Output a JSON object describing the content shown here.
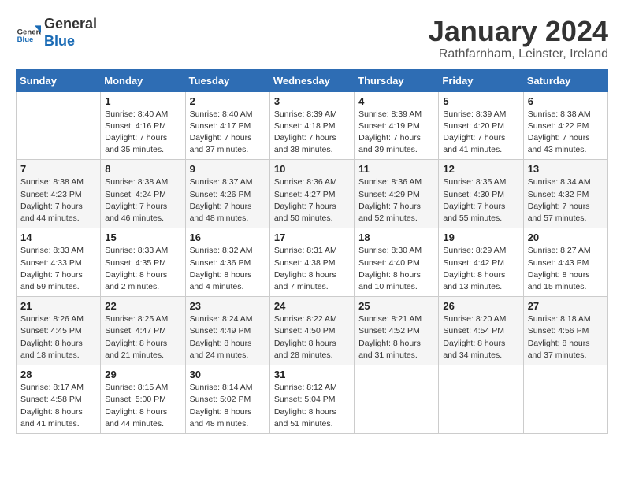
{
  "header": {
    "logo_general": "General",
    "logo_blue": "Blue",
    "month_title": "January 2024",
    "location": "Rathfarnham, Leinster, Ireland"
  },
  "calendar": {
    "days_of_week": [
      "Sunday",
      "Monday",
      "Tuesday",
      "Wednesday",
      "Thursday",
      "Friday",
      "Saturday"
    ],
    "weeks": [
      [
        {
          "day": "",
          "info": ""
        },
        {
          "day": "1",
          "info": "Sunrise: 8:40 AM\nSunset: 4:16 PM\nDaylight: 7 hours\nand 35 minutes."
        },
        {
          "day": "2",
          "info": "Sunrise: 8:40 AM\nSunset: 4:17 PM\nDaylight: 7 hours\nand 37 minutes."
        },
        {
          "day": "3",
          "info": "Sunrise: 8:39 AM\nSunset: 4:18 PM\nDaylight: 7 hours\nand 38 minutes."
        },
        {
          "day": "4",
          "info": "Sunrise: 8:39 AM\nSunset: 4:19 PM\nDaylight: 7 hours\nand 39 minutes."
        },
        {
          "day": "5",
          "info": "Sunrise: 8:39 AM\nSunset: 4:20 PM\nDaylight: 7 hours\nand 41 minutes."
        },
        {
          "day": "6",
          "info": "Sunrise: 8:38 AM\nSunset: 4:22 PM\nDaylight: 7 hours\nand 43 minutes."
        }
      ],
      [
        {
          "day": "7",
          "info": "Sunrise: 8:38 AM\nSunset: 4:23 PM\nDaylight: 7 hours\nand 44 minutes."
        },
        {
          "day": "8",
          "info": "Sunrise: 8:38 AM\nSunset: 4:24 PM\nDaylight: 7 hours\nand 46 minutes."
        },
        {
          "day": "9",
          "info": "Sunrise: 8:37 AM\nSunset: 4:26 PM\nDaylight: 7 hours\nand 48 minutes."
        },
        {
          "day": "10",
          "info": "Sunrise: 8:36 AM\nSunset: 4:27 PM\nDaylight: 7 hours\nand 50 minutes."
        },
        {
          "day": "11",
          "info": "Sunrise: 8:36 AM\nSunset: 4:29 PM\nDaylight: 7 hours\nand 52 minutes."
        },
        {
          "day": "12",
          "info": "Sunrise: 8:35 AM\nSunset: 4:30 PM\nDaylight: 7 hours\nand 55 minutes."
        },
        {
          "day": "13",
          "info": "Sunrise: 8:34 AM\nSunset: 4:32 PM\nDaylight: 7 hours\nand 57 minutes."
        }
      ],
      [
        {
          "day": "14",
          "info": "Sunrise: 8:33 AM\nSunset: 4:33 PM\nDaylight: 7 hours\nand 59 minutes."
        },
        {
          "day": "15",
          "info": "Sunrise: 8:33 AM\nSunset: 4:35 PM\nDaylight: 8 hours\nand 2 minutes."
        },
        {
          "day": "16",
          "info": "Sunrise: 8:32 AM\nSunset: 4:36 PM\nDaylight: 8 hours\nand 4 minutes."
        },
        {
          "day": "17",
          "info": "Sunrise: 8:31 AM\nSunset: 4:38 PM\nDaylight: 8 hours\nand 7 minutes."
        },
        {
          "day": "18",
          "info": "Sunrise: 8:30 AM\nSunset: 4:40 PM\nDaylight: 8 hours\nand 10 minutes."
        },
        {
          "day": "19",
          "info": "Sunrise: 8:29 AM\nSunset: 4:42 PM\nDaylight: 8 hours\nand 13 minutes."
        },
        {
          "day": "20",
          "info": "Sunrise: 8:27 AM\nSunset: 4:43 PM\nDaylight: 8 hours\nand 15 minutes."
        }
      ],
      [
        {
          "day": "21",
          "info": "Sunrise: 8:26 AM\nSunset: 4:45 PM\nDaylight: 8 hours\nand 18 minutes."
        },
        {
          "day": "22",
          "info": "Sunrise: 8:25 AM\nSunset: 4:47 PM\nDaylight: 8 hours\nand 21 minutes."
        },
        {
          "day": "23",
          "info": "Sunrise: 8:24 AM\nSunset: 4:49 PM\nDaylight: 8 hours\nand 24 minutes."
        },
        {
          "day": "24",
          "info": "Sunrise: 8:22 AM\nSunset: 4:50 PM\nDaylight: 8 hours\nand 28 minutes."
        },
        {
          "day": "25",
          "info": "Sunrise: 8:21 AM\nSunset: 4:52 PM\nDaylight: 8 hours\nand 31 minutes."
        },
        {
          "day": "26",
          "info": "Sunrise: 8:20 AM\nSunset: 4:54 PM\nDaylight: 8 hours\nand 34 minutes."
        },
        {
          "day": "27",
          "info": "Sunrise: 8:18 AM\nSunset: 4:56 PM\nDaylight: 8 hours\nand 37 minutes."
        }
      ],
      [
        {
          "day": "28",
          "info": "Sunrise: 8:17 AM\nSunset: 4:58 PM\nDaylight: 8 hours\nand 41 minutes."
        },
        {
          "day": "29",
          "info": "Sunrise: 8:15 AM\nSunset: 5:00 PM\nDaylight: 8 hours\nand 44 minutes."
        },
        {
          "day": "30",
          "info": "Sunrise: 8:14 AM\nSunset: 5:02 PM\nDaylight: 8 hours\nand 48 minutes."
        },
        {
          "day": "31",
          "info": "Sunrise: 8:12 AM\nSunset: 5:04 PM\nDaylight: 8 hours\nand 51 minutes."
        },
        {
          "day": "",
          "info": ""
        },
        {
          "day": "",
          "info": ""
        },
        {
          "day": "",
          "info": ""
        }
      ]
    ]
  }
}
